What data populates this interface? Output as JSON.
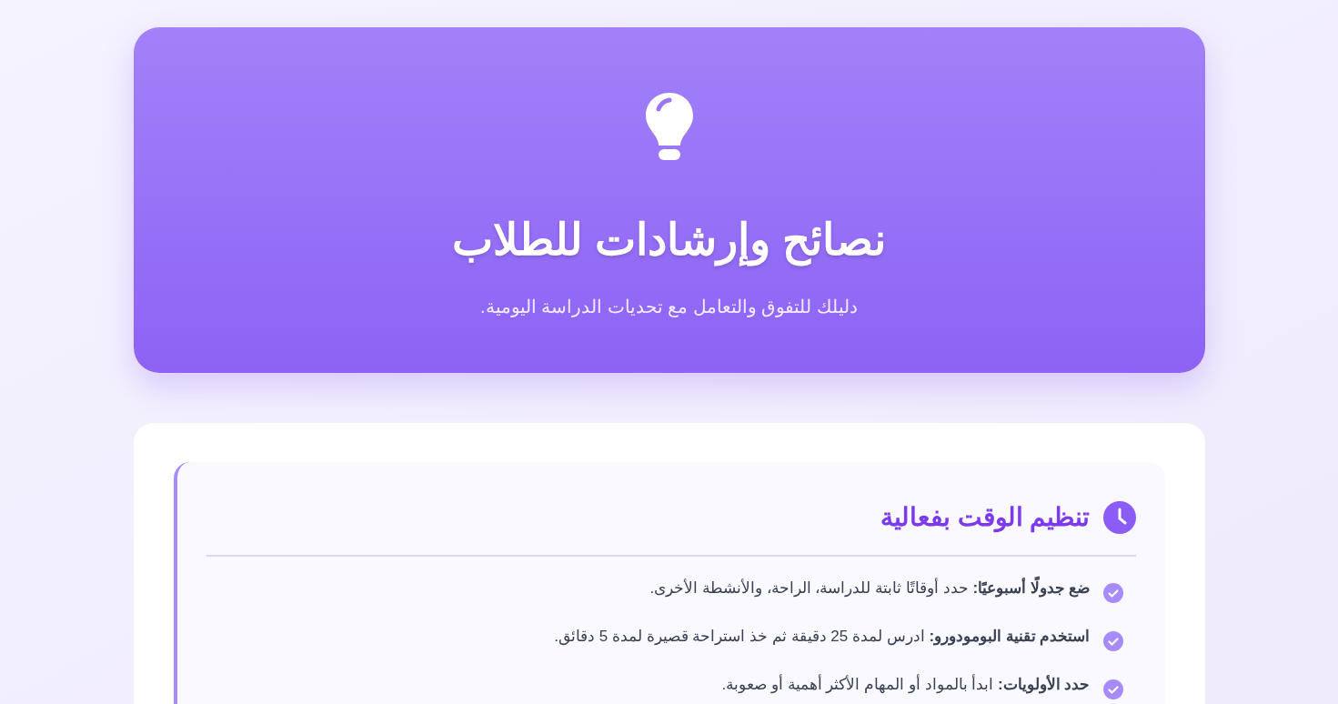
{
  "hero": {
    "title": "نصائح وإرشادات للطلاب",
    "subtitle": "دليلك للتفوق والتعامل مع تحديات الدراسة اليومية."
  },
  "sections": [
    {
      "title": "تنظيم الوقت بفعالية",
      "items": [
        {
          "text": "**ضع جدولًا أسبوعيًا:** حدد أوقاتًا ثابتة للدراسة، الراحة، والأنشطة الأخرى."
        },
        {
          "text": "**استخدم تقنية البومودورو:** ادرس لمدة 25 دقيقة ثم خذ استراحة قصيرة لمدة 5 دقائق."
        },
        {
          "text": "**حدد الأولويات:** ابدأ بالمواد أو المهام الأكثر أهمية أو صعوبة."
        }
      ]
    }
  ]
}
